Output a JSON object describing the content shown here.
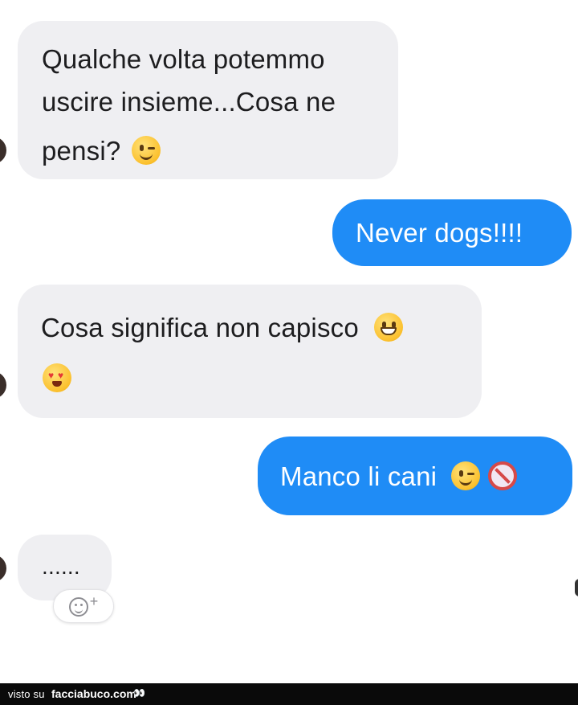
{
  "messages": [
    {
      "side": "in",
      "lines": [
        "Qualche volta potemmo",
        "uscire insieme...Cosa ne",
        "pensi?"
      ],
      "emojis": [
        "wink-emoji"
      ]
    },
    {
      "side": "out",
      "text": "Never dogs!!!!"
    },
    {
      "side": "in",
      "text": "Cosa significa non capisco",
      "emojis": [
        "grin-emoji",
        "heart-eyes-emoji"
      ]
    },
    {
      "side": "out",
      "text": "Manco li cani",
      "emojis": [
        "wink-emoji",
        "no-entry-icon"
      ]
    },
    {
      "side": "in",
      "text": "......"
    }
  ],
  "reaction_button": {
    "icon": "add-reaction-icon",
    "plus": "+"
  },
  "footer": {
    "prefix": "visto su",
    "site": "facciabuco.com",
    "logo": "👀"
  },
  "colors": {
    "incoming": "#efeff2",
    "outgoing": "#1f8cf6",
    "footer": "#0a0a0a"
  }
}
